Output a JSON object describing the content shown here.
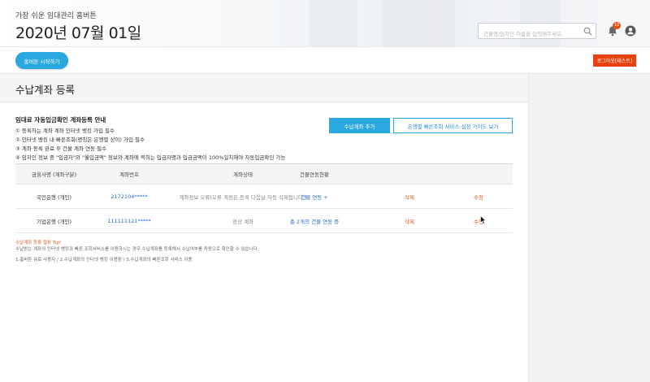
{
  "header": {
    "subtitle": "가장 쉬운 임대관리 홈버튼",
    "date": "2020년 07월 01일",
    "search_placeholder": "건물명/임차인 이름을 입력해주세요.",
    "notification_count": "10",
    "icons": [
      "search-icon",
      "bell-icon",
      "user-icon"
    ]
  },
  "actionbar": {
    "start_label": "홈버튼 시작하기",
    "logout_label": "로그아웃[테스트]"
  },
  "page": {
    "title": "수납계좌 등록"
  },
  "guide": {
    "title": "임대료 자동입금확인 계좌등록 안내",
    "lines": [
      "① 등록하는 계좌 계좌 인터넷 뱅킹 가입 필수",
      "② 인터넷 뱅킹 내 빠른조회(명칭은 은행별 상이) 가입 필수",
      "③ 계좌 등록 완료 후 건물 계좌 연동 필수",
      "④ 임차인 정보 중 \"입금자\"와 \"월입금액\" 정보와 계좌에 찍히는 입금자명과 입금금액이 100%일치해야 자동입금확인 가능"
    ],
    "add_button": "수납계좌 추가",
    "guide_button": "은행별 빠른조회 서비스 설정 가이드 보기"
  },
  "table": {
    "headers": [
      "금융사명 (계좌구분)",
      "계좌번호",
      "계좌상태",
      "건물연동현황"
    ],
    "rows": [
      {
        "bank": "국민은행 (개인)",
        "account": "2172104*****",
        "status": "계좌정보 오류(오류 계정은 등록 다음날 자동 삭제됩니다.)",
        "link": "건물 연동 +",
        "delete": "삭제",
        "edit": "수정"
      },
      {
        "bank": "기업은행 (개인)",
        "account": "111111121*****",
        "status": "정상 계좌",
        "link": "총 2개의 건물 연동 중",
        "delete": "삭제",
        "edit": "수정"
      }
    ]
  },
  "notes": {
    "title": "수납계좌 등록 절차 Tip!",
    "line1": "수납받는 계좌의 인터넷 뱅킹과 빠른 조회서비스를 이용하시는 경우 수납계좌를 등록해서 수납여부를 자동으로 확인할 수 있습니다.",
    "line2": "1.홈버튼 유료 사용자 / 2.수납계좌의 인터넷 뱅킹 이용중 / 3.수납계좌의 빠른조회 서비스 이용"
  },
  "colors": {
    "accent": "#2aa8e0",
    "danger": "#e8420f",
    "link": "#2a6fc9"
  }
}
